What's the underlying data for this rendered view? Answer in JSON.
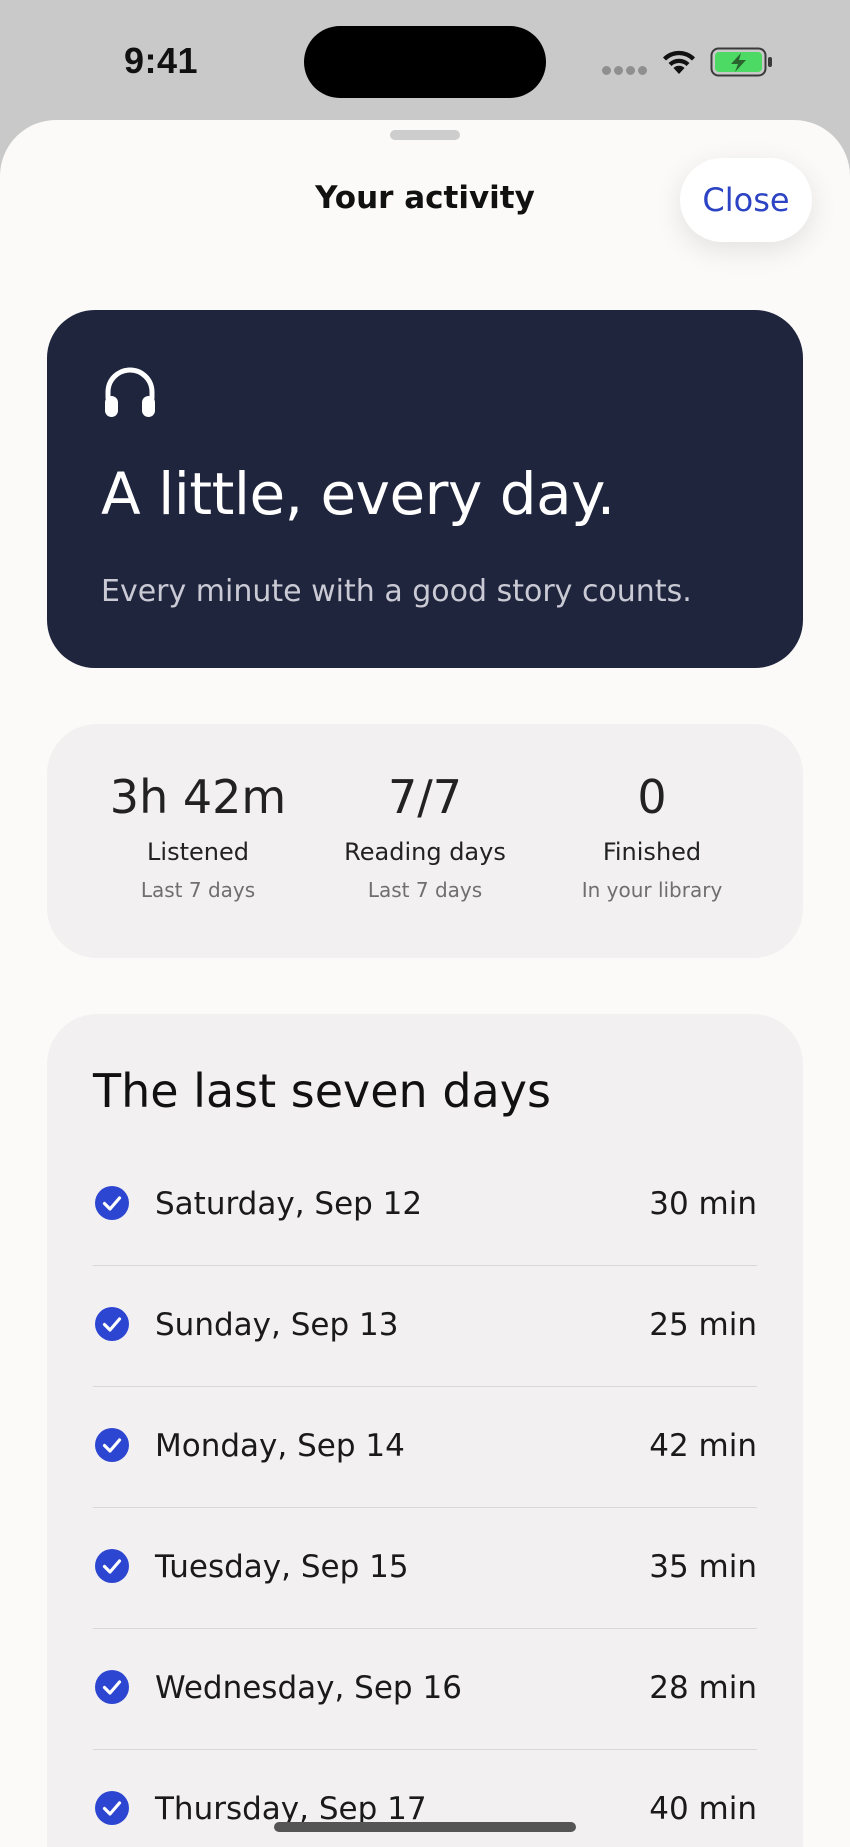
{
  "status_bar": {
    "time": "9:41",
    "signal_icon": "signal-dots-icon",
    "wifi_icon": "wifi-icon",
    "battery_icon": "battery-charging-icon"
  },
  "sheet": {
    "title": "Your activity",
    "close_label": "Close"
  },
  "hero": {
    "icon": "headphones-icon",
    "title": "A little, every day.",
    "subtitle": "Every minute with a good story counts."
  },
  "stats": [
    {
      "value": "3h 42m",
      "label": "Listened",
      "sub": "Last 7 days"
    },
    {
      "value": "7/7",
      "label": "Reading days",
      "sub": "Last 7 days"
    },
    {
      "value": "0",
      "label": "Finished",
      "sub": "In your library"
    }
  ],
  "days_section": {
    "title": "The last seven days",
    "rows": [
      {
        "day": "Saturday, Sep 12",
        "value": "30 min",
        "completed": true
      },
      {
        "day": "Sunday, Sep 13",
        "value": "25 min",
        "completed": true
      },
      {
        "day": "Monday, Sep 14",
        "value": "42 min",
        "completed": true
      },
      {
        "day": "Tuesday, Sep 15",
        "value": "35 min",
        "completed": true
      },
      {
        "day": "Wednesday, Sep 16",
        "value": "28 min",
        "completed": true
      },
      {
        "day": "Thursday, Sep 17",
        "value": "40 min",
        "completed": true
      }
    ]
  },
  "colors": {
    "accent": "#2c44c4",
    "hero_bg": "#20253e",
    "card_bg": "#f2f0f0",
    "check_blue": "#2d46d2",
    "battery_green": "#4cd964"
  }
}
